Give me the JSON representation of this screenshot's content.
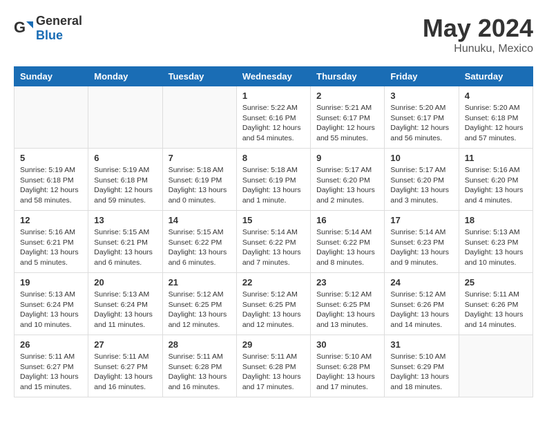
{
  "header": {
    "logo_general": "General",
    "logo_blue": "Blue",
    "title": "May 2024",
    "location": "Hunuku, Mexico"
  },
  "weekdays": [
    "Sunday",
    "Monday",
    "Tuesday",
    "Wednesday",
    "Thursday",
    "Friday",
    "Saturday"
  ],
  "weeks": [
    [
      {
        "day": "",
        "info": ""
      },
      {
        "day": "",
        "info": ""
      },
      {
        "day": "",
        "info": ""
      },
      {
        "day": "1",
        "info": "Sunrise: 5:22 AM\nSunset: 6:16 PM\nDaylight: 12 hours\nand 54 minutes."
      },
      {
        "day": "2",
        "info": "Sunrise: 5:21 AM\nSunset: 6:17 PM\nDaylight: 12 hours\nand 55 minutes."
      },
      {
        "day": "3",
        "info": "Sunrise: 5:20 AM\nSunset: 6:17 PM\nDaylight: 12 hours\nand 56 minutes."
      },
      {
        "day": "4",
        "info": "Sunrise: 5:20 AM\nSunset: 6:18 PM\nDaylight: 12 hours\nand 57 minutes."
      }
    ],
    [
      {
        "day": "5",
        "info": "Sunrise: 5:19 AM\nSunset: 6:18 PM\nDaylight: 12 hours\nand 58 minutes."
      },
      {
        "day": "6",
        "info": "Sunrise: 5:19 AM\nSunset: 6:18 PM\nDaylight: 12 hours\nand 59 minutes."
      },
      {
        "day": "7",
        "info": "Sunrise: 5:18 AM\nSunset: 6:19 PM\nDaylight: 13 hours\nand 0 minutes."
      },
      {
        "day": "8",
        "info": "Sunrise: 5:18 AM\nSunset: 6:19 PM\nDaylight: 13 hours\nand 1 minute."
      },
      {
        "day": "9",
        "info": "Sunrise: 5:17 AM\nSunset: 6:20 PM\nDaylight: 13 hours\nand 2 minutes."
      },
      {
        "day": "10",
        "info": "Sunrise: 5:17 AM\nSunset: 6:20 PM\nDaylight: 13 hours\nand 3 minutes."
      },
      {
        "day": "11",
        "info": "Sunrise: 5:16 AM\nSunset: 6:20 PM\nDaylight: 13 hours\nand 4 minutes."
      }
    ],
    [
      {
        "day": "12",
        "info": "Sunrise: 5:16 AM\nSunset: 6:21 PM\nDaylight: 13 hours\nand 5 minutes."
      },
      {
        "day": "13",
        "info": "Sunrise: 5:15 AM\nSunset: 6:21 PM\nDaylight: 13 hours\nand 6 minutes."
      },
      {
        "day": "14",
        "info": "Sunrise: 5:15 AM\nSunset: 6:22 PM\nDaylight: 13 hours\nand 6 minutes."
      },
      {
        "day": "15",
        "info": "Sunrise: 5:14 AM\nSunset: 6:22 PM\nDaylight: 13 hours\nand 7 minutes."
      },
      {
        "day": "16",
        "info": "Sunrise: 5:14 AM\nSunset: 6:22 PM\nDaylight: 13 hours\nand 8 minutes."
      },
      {
        "day": "17",
        "info": "Sunrise: 5:14 AM\nSunset: 6:23 PM\nDaylight: 13 hours\nand 9 minutes."
      },
      {
        "day": "18",
        "info": "Sunrise: 5:13 AM\nSunset: 6:23 PM\nDaylight: 13 hours\nand 10 minutes."
      }
    ],
    [
      {
        "day": "19",
        "info": "Sunrise: 5:13 AM\nSunset: 6:24 PM\nDaylight: 13 hours\nand 10 minutes."
      },
      {
        "day": "20",
        "info": "Sunrise: 5:13 AM\nSunset: 6:24 PM\nDaylight: 13 hours\nand 11 minutes."
      },
      {
        "day": "21",
        "info": "Sunrise: 5:12 AM\nSunset: 6:25 PM\nDaylight: 13 hours\nand 12 minutes."
      },
      {
        "day": "22",
        "info": "Sunrise: 5:12 AM\nSunset: 6:25 PM\nDaylight: 13 hours\nand 12 minutes."
      },
      {
        "day": "23",
        "info": "Sunrise: 5:12 AM\nSunset: 6:25 PM\nDaylight: 13 hours\nand 13 minutes."
      },
      {
        "day": "24",
        "info": "Sunrise: 5:12 AM\nSunset: 6:26 PM\nDaylight: 13 hours\nand 14 minutes."
      },
      {
        "day": "25",
        "info": "Sunrise: 5:11 AM\nSunset: 6:26 PM\nDaylight: 13 hours\nand 14 minutes."
      }
    ],
    [
      {
        "day": "26",
        "info": "Sunrise: 5:11 AM\nSunset: 6:27 PM\nDaylight: 13 hours\nand 15 minutes."
      },
      {
        "day": "27",
        "info": "Sunrise: 5:11 AM\nSunset: 6:27 PM\nDaylight: 13 hours\nand 16 minutes."
      },
      {
        "day": "28",
        "info": "Sunrise: 5:11 AM\nSunset: 6:28 PM\nDaylight: 13 hours\nand 16 minutes."
      },
      {
        "day": "29",
        "info": "Sunrise: 5:11 AM\nSunset: 6:28 PM\nDaylight: 13 hours\nand 17 minutes."
      },
      {
        "day": "30",
        "info": "Sunrise: 5:10 AM\nSunset: 6:28 PM\nDaylight: 13 hours\nand 17 minutes."
      },
      {
        "day": "31",
        "info": "Sunrise: 5:10 AM\nSunset: 6:29 PM\nDaylight: 13 hours\nand 18 minutes."
      },
      {
        "day": "",
        "info": ""
      }
    ]
  ]
}
